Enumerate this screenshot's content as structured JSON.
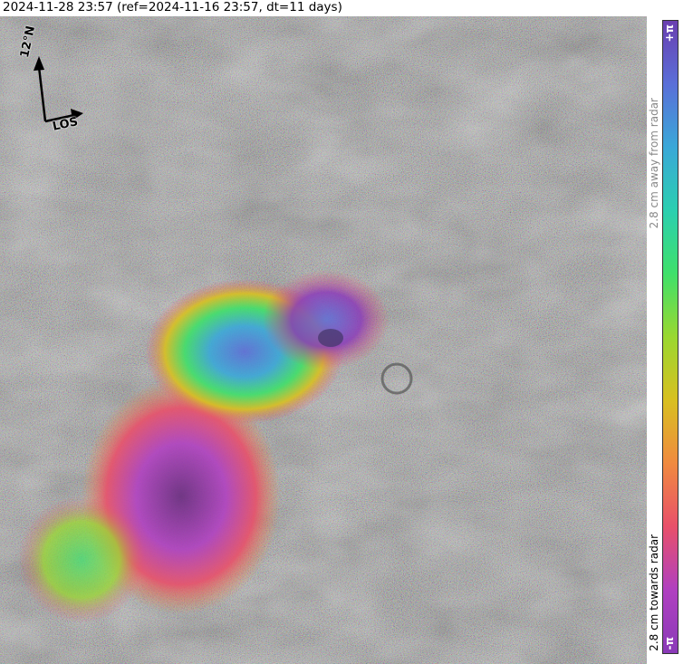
{
  "header": {
    "title": "2024-11-28 23:57 (ref=2024-11-16 23:57, dt=11 days)"
  },
  "compass": {
    "north_label": "12°N",
    "los_label": "LOS"
  },
  "colorbar": {
    "top_label": "+π",
    "bottom_label": "-π",
    "away_label": "2.8 cm away from radar",
    "towards_label": "2.8 cm towards radar",
    "colors": [
      "#6a3fb0",
      "#5a6fd8",
      "#3aa8d8",
      "#2bcfb0",
      "#3fe06a",
      "#9ad830",
      "#d8c020",
      "#f08a40",
      "#e8506a",
      "#b040c0",
      "#8a3ab8"
    ]
  },
  "map": {
    "feature": "volcano interferogram"
  }
}
